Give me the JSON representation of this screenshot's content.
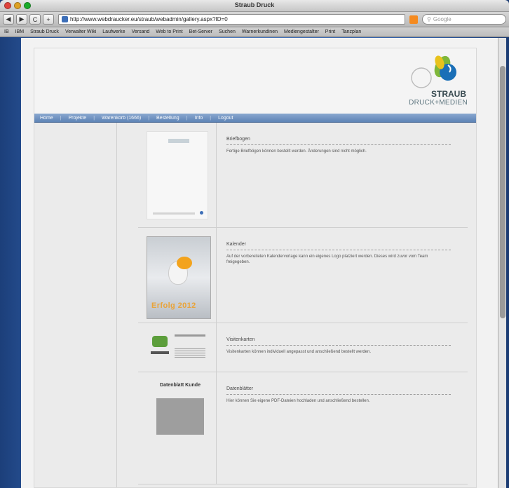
{
  "window": {
    "title": "Straub Druck"
  },
  "toolbar": {
    "back": "◀",
    "forward": "▶",
    "reload": "C",
    "add": "+",
    "url": "http://www.webdraucker.eu/straub/webadmin/gallery.aspx?ID=0",
    "search_placeholder": "Google"
  },
  "bookmarks": [
    "IB",
    "IBM",
    "Straub Druck",
    "Verwalter Wiki",
    "Laufwerke",
    "Versand",
    "Web to Print",
    "Bet-Server",
    "Suchen",
    "Warnerkundinen",
    "Mediengestalter",
    "Print",
    "Tanzplan"
  ],
  "logo": {
    "line1": "STRAUB",
    "line2": "DRUCK+MEDIEN"
  },
  "nav": [
    "Home",
    "Projekte",
    "Warenkorb (1666)",
    "Bestellung",
    "Info",
    "Logout"
  ],
  "products": [
    {
      "title": "Briefbogen",
      "desc": "Fertige Briefbögen können bestellt werden. Änderungen sind nicht möglich."
    },
    {
      "title": "Kalender",
      "desc": "Auf der vorbereiteten Kalendervorlage kann ein eigenes Logo platziert werden. Dieses wird zuvor vom Team freigegeben.",
      "thumb_text": "Erfolg 2012"
    },
    {
      "title": "Visitenkarten",
      "desc": "Visitenkarten können individuell angepasst und anschließend bestellt werden."
    },
    {
      "title": "Datenblätter",
      "desc": "Hier können Sie eigene PDF-Dateien hochladen und anschließend bestellen.",
      "thumb_text": "Datenblatt Kunde"
    }
  ]
}
